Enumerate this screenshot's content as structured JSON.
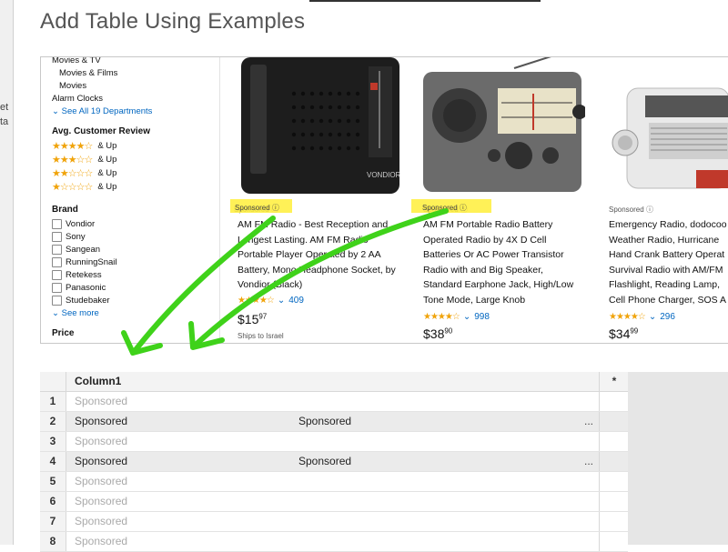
{
  "dialog": {
    "title": "Add Table Using Examples"
  },
  "left_strip": {
    "fragments": [
      "et",
      "ta"
    ]
  },
  "sidebar": {
    "dept_items": [
      "Movies & TV",
      "Movies & Films",
      "Movies",
      "Alarm Clocks"
    ],
    "see_all": "See All 19 Departments",
    "review_heading": "Avg. Customer Review",
    "review_rows": [
      {
        "stars": "★★★★☆",
        "label": "& Up",
        "value": 4
      },
      {
        "stars": "★★★☆☆",
        "label": "& Up",
        "value": 3
      },
      {
        "stars": "★★☆☆☆",
        "label": "& Up",
        "value": 2
      },
      {
        "stars": "★☆☆☆☆",
        "label": "& Up",
        "value": 1
      }
    ],
    "brand_heading": "Brand",
    "brands": [
      "Vondior",
      "Sony",
      "Sangean",
      "RunningSnail",
      "Retekess",
      "Panasonic",
      "Studebaker"
    ],
    "see_more": "See more",
    "price_heading": "Price"
  },
  "products": [
    {
      "sponsored": "Sponsored",
      "lines": [
        "AM FM Radio - Best Reception and",
        "Longest Lasting. AM FM Radio",
        "Portable Player Operated by 2 AA",
        "Battery, Mono Headphone Socket, by",
        "Vondior (Black)"
      ],
      "stars": "★★★★☆",
      "reviews": "409",
      "price_whole": "$15",
      "price_cents": "97",
      "shipping": "Ships to Israel",
      "brand_label": "VONDIOR"
    },
    {
      "sponsored": "Sponsored",
      "lines": [
        "AM FM Portable Radio Battery",
        "Operated Radio by 4X D Cell",
        "Batteries Or AC Power Transistor",
        "Radio with and Big Speaker,",
        "Standard Earphone Jack, High/Low",
        "Tone Mode, Large Knob"
      ],
      "stars": "★★★★☆",
      "reviews": "998",
      "price_whole": "$38",
      "price_cents": "90"
    },
    {
      "sponsored": "Sponsored",
      "lines": [
        "Emergency Radio, dodocoo",
        "Weather Radio, Hurricane",
        "Hand Crank Battery Operat",
        "Survival Radio with AM/FM",
        "Flashlight, Reading Lamp,",
        "Cell Phone Charger, SOS A"
      ],
      "stars": "★★★★☆",
      "reviews": "296",
      "price_whole": "$34",
      "price_cents": "99"
    }
  ],
  "table": {
    "header": "Column1",
    "add_column": "*",
    "rows": [
      {
        "num": "1",
        "c1": "Sponsored",
        "c2": "",
        "more": "",
        "state": "placeholder"
      },
      {
        "num": "2",
        "c1": "Sponsored",
        "c2": "Sponsored",
        "more": "...",
        "state": "filled"
      },
      {
        "num": "3",
        "c1": "Sponsored",
        "c2": "",
        "more": "",
        "state": "placeholder"
      },
      {
        "num": "4",
        "c1": "Sponsored",
        "c2": "Sponsored",
        "more": "...",
        "state": "filled"
      },
      {
        "num": "5",
        "c1": "Sponsored",
        "c2": "",
        "more": "",
        "state": "placeholder"
      },
      {
        "num": "6",
        "c1": "Sponsored",
        "c2": "",
        "more": "",
        "state": "placeholder"
      },
      {
        "num": "7",
        "c1": "Sponsored",
        "c2": "",
        "more": "",
        "state": "placeholder"
      },
      {
        "num": "8",
        "c1": "Sponsored",
        "c2": "",
        "more": "",
        "state": "placeholder"
      }
    ]
  },
  "colors": {
    "highlight": "#ffef3a",
    "annotation_arrow": "#3fd21a",
    "link": "#0066c0",
    "star": "#f0a30a",
    "placeholder_text": "#aaaaaa",
    "selected_row": "#ebebeb"
  }
}
